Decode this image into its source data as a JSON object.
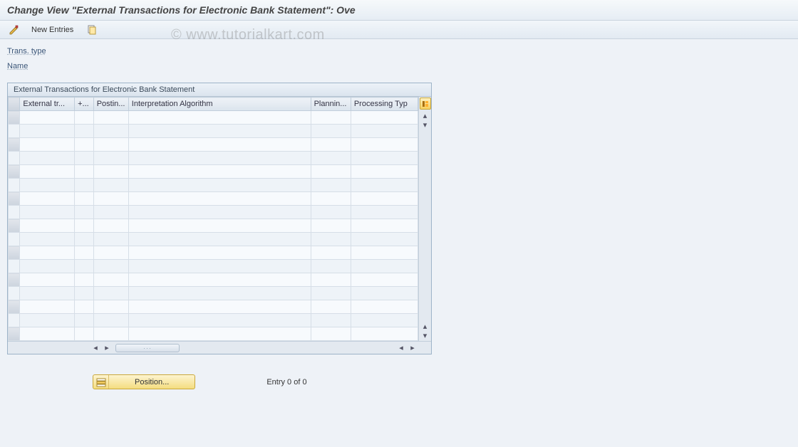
{
  "watermark": "© www.tutorialkart.com",
  "title": "Change View \"External Transactions for Electronic Bank Statement\": Ove",
  "toolbar": {
    "new_entries_label": "New Entries",
    "icons": {
      "detail": "detail-icon",
      "copy": "copy-icon"
    }
  },
  "details": {
    "trans_type_label": "Trans. type",
    "trans_type_value": "",
    "name_label": "Name",
    "name_value": ""
  },
  "table": {
    "panel_title": "External Transactions for Electronic Bank Statement",
    "columns": [
      "External tr...",
      "+...",
      "Postin...",
      "Interpretation Algorithm",
      "Plannin...",
      "Processing Typ"
    ],
    "row_count": 17
  },
  "footer": {
    "position_label": "Position...",
    "entry_status": "Entry 0 of 0"
  }
}
